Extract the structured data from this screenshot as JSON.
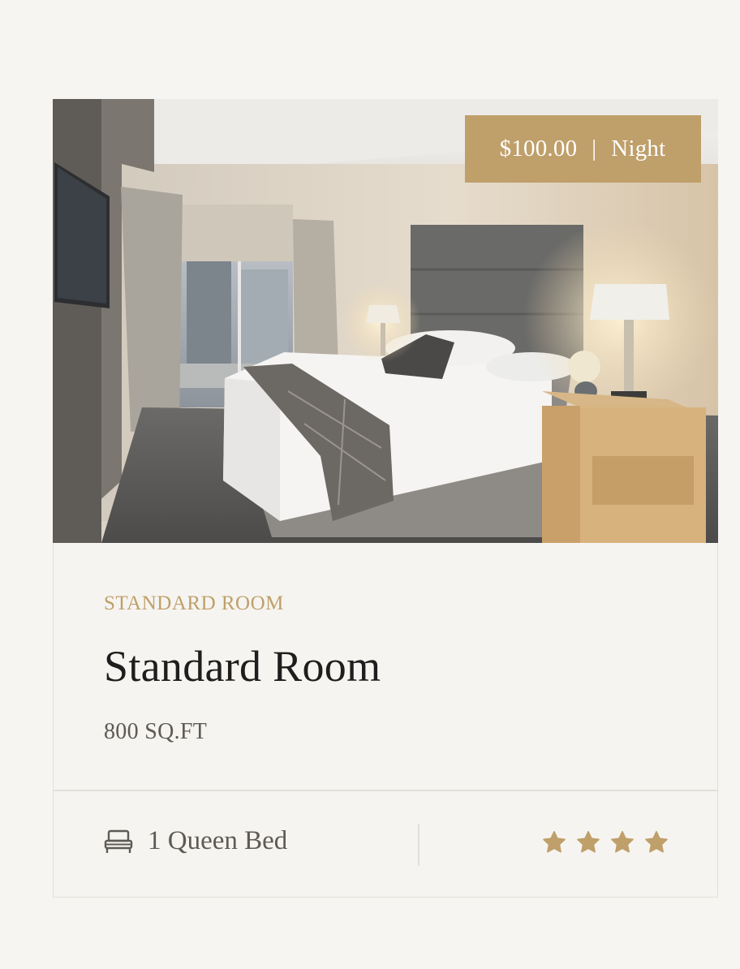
{
  "room": {
    "price": "$100.00",
    "price_separator": "|",
    "price_unit": "Night",
    "category": "STANDARD ROOM",
    "title": "Standard Room",
    "size": "800 SQ.FT",
    "bed_label": "1 Queen Bed",
    "bed_icon": "bed-icon",
    "rating": 4,
    "rating_max": 4,
    "star_icon": "star-icon"
  },
  "colors": {
    "accent": "#bf9f6a",
    "background": "#f7f5f1",
    "title_text": "#1e1e1e",
    "body_text": "#5e5a55",
    "border": "#e3e0db"
  }
}
